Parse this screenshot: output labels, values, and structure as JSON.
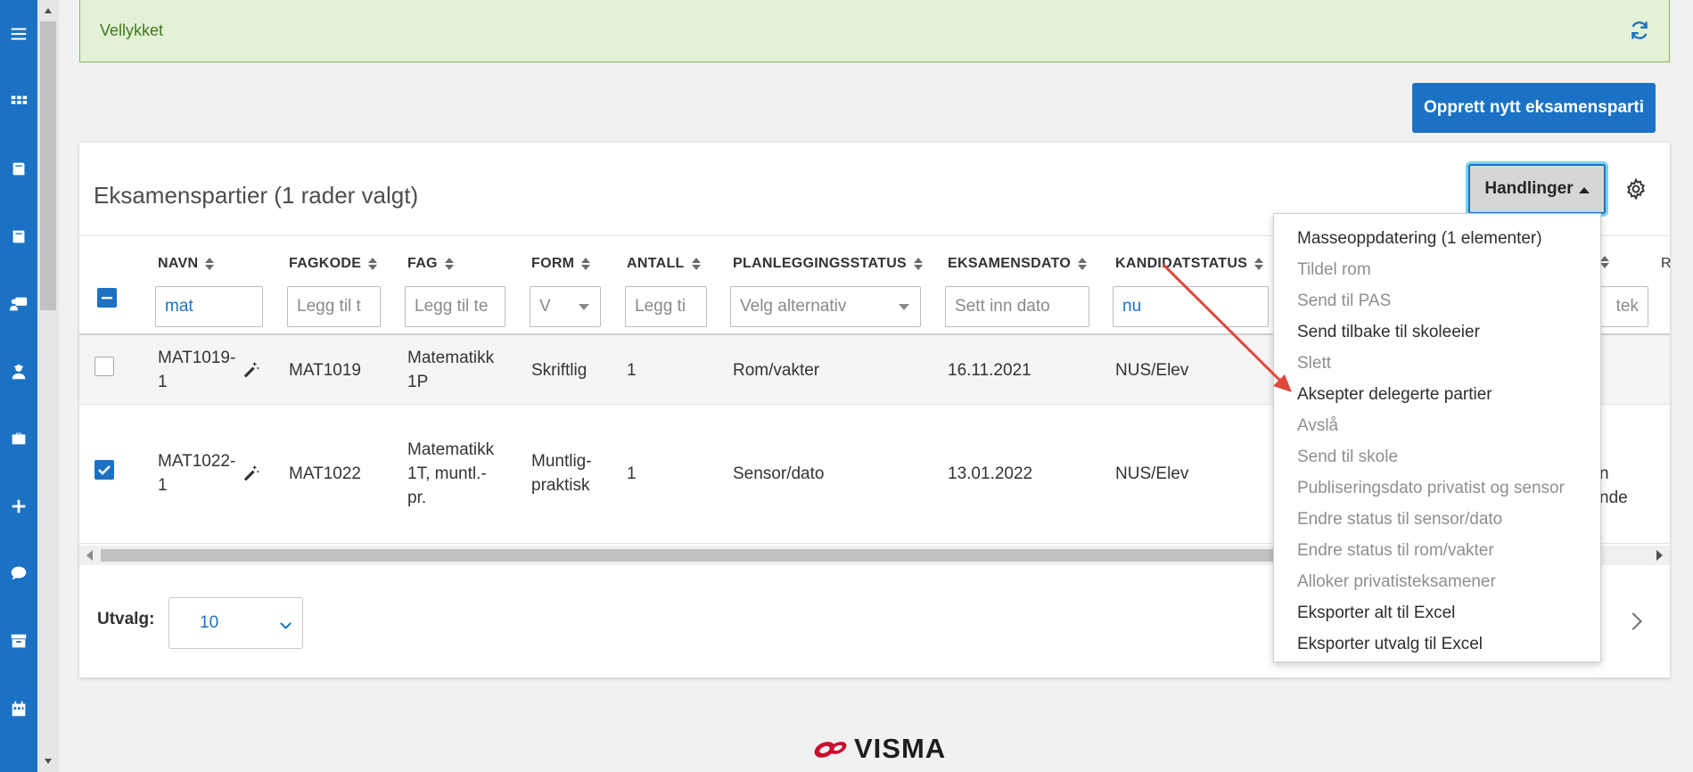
{
  "alert": {
    "text": "Vellykket"
  },
  "create_button": "Opprett nytt eksamensparti",
  "card": {
    "title": "Eksamenspartier (1 rader valgt)"
  },
  "actions_button": "Handlinger",
  "columns": [
    {
      "label": "NAVN",
      "filter": "mat",
      "filter_placeholder": ""
    },
    {
      "label": "FAGKODE",
      "filter": "",
      "filter_placeholder": "Legg til t"
    },
    {
      "label": "FAG",
      "filter": "",
      "filter_placeholder": "Legg til te"
    },
    {
      "label": "FORM",
      "filter": "",
      "filter_placeholder": "V"
    },
    {
      "label": "ANTALL",
      "filter": "",
      "filter_placeholder": "Legg ti"
    },
    {
      "label": "PLANLEGGINGSSTATUS",
      "filter": "",
      "filter_placeholder": "Velg alternativ"
    },
    {
      "label": "EKSAMENSDATO",
      "filter": "",
      "filter_placeholder": "Sett inn dato"
    },
    {
      "label": "KANDIDATSTATUS",
      "filter": "nu",
      "filter_placeholder": ""
    }
  ],
  "hidden_column_fragments": {
    "filter_tail": "tek",
    "header_tail": "R",
    "row2_tail_1": "n",
    "row2_tail_2": "nde"
  },
  "rows": [
    {
      "checked": false,
      "navn": "MAT1019-1",
      "navn_line1": "MAT1019-",
      "navn_line2": "1",
      "fagkode": "MAT1019",
      "fag_line1": "Matematikk",
      "fag_line2": "1P",
      "fag_line3": "",
      "form_line1": "Skriftlig",
      "form_line2": "",
      "antall": "1",
      "planleggingsstatus": "Rom/vakter",
      "eksamensdato": "16.11.2021",
      "kandidatstatus": "NUS/Elev"
    },
    {
      "checked": true,
      "navn": "MAT1022-1",
      "navn_line1": "MAT1022-",
      "navn_line2": "1",
      "fagkode": "MAT1022",
      "fag_line1": "Matematikk",
      "fag_line2": "1T, muntl.-",
      "fag_line3": "pr.",
      "form_line1": "Muntlig-",
      "form_line2": "praktisk",
      "antall": "1",
      "planleggingsstatus": "Sensor/dato",
      "eksamensdato": "13.01.2022",
      "kandidatstatus": "NUS/Elev"
    }
  ],
  "footer": {
    "utvalg_label": "Utvalg:",
    "page_size": "10"
  },
  "menu": {
    "items": [
      {
        "label": "Masseoppdatering (1 elementer)",
        "enabled": true
      },
      {
        "label": "Tildel rom",
        "enabled": false
      },
      {
        "label": "Send til PAS",
        "enabled": false
      },
      {
        "label": "Send tilbake til skoleeier",
        "enabled": true
      },
      {
        "label": "Slett",
        "enabled": false
      },
      {
        "label": "Aksepter delegerte partier",
        "enabled": true
      },
      {
        "label": "Avslå",
        "enabled": false
      },
      {
        "label": "Send til skole",
        "enabled": false
      },
      {
        "label": "Publiseringsdato privatist og sensor",
        "enabled": false
      },
      {
        "label": "Endre status til sensor/dato",
        "enabled": false
      },
      {
        "label": "Endre status til rom/vakter",
        "enabled": false
      },
      {
        "label": "Alloker privatisteksamener",
        "enabled": false
      },
      {
        "label": "Eksporter alt til Excel",
        "enabled": true
      },
      {
        "label": "Eksporter utvalg til Excel",
        "enabled": true
      }
    ]
  },
  "logo": {
    "text": "VISMA"
  },
  "nav_icons": [
    "menu-icon",
    "grid-icon",
    "book-icon",
    "book-icon",
    "teacher-icon",
    "student-icon",
    "briefcase-icon",
    "plus-icon",
    "chat-icon",
    "archive-icon",
    "calendar-icon"
  ],
  "colors": {
    "primary": "#1b72c4",
    "success_bg": "#e3f1d6",
    "success_text": "#3f7a1c",
    "annotation_arrow": "#e0483c"
  }
}
